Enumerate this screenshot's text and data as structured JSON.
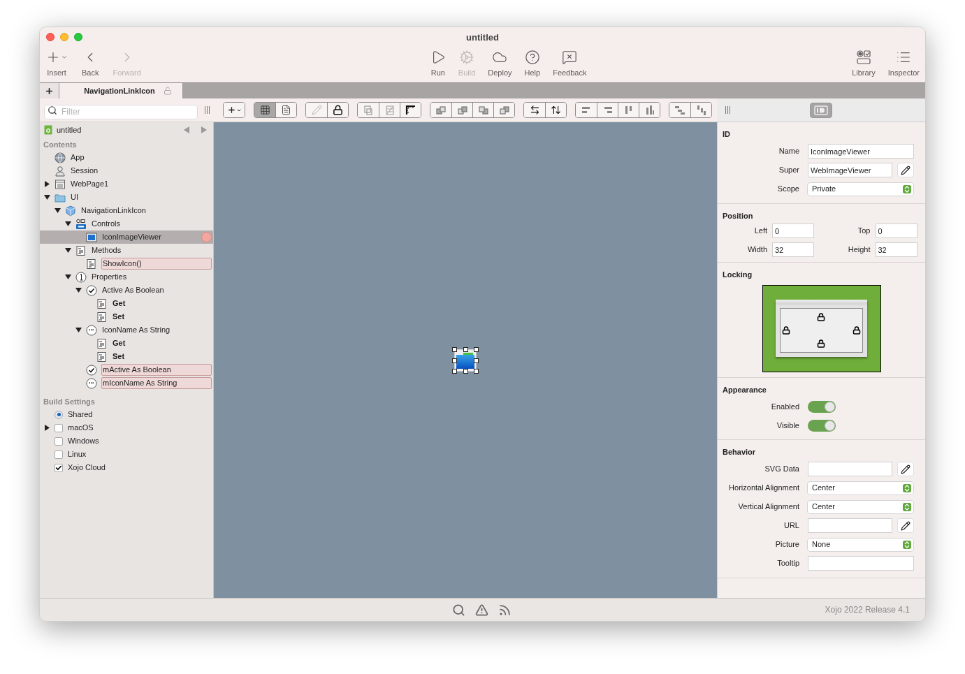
{
  "window": {
    "title": "untitled"
  },
  "toolbar_left": [
    {
      "label": "Insert",
      "kind": "insert",
      "disabled": false
    },
    {
      "label": "Back",
      "kind": "back",
      "disabled": false
    },
    {
      "label": "Forward",
      "kind": "forward",
      "disabled": true
    }
  ],
  "toolbar_center": [
    {
      "label": "Run",
      "kind": "run",
      "disabled": false
    },
    {
      "label": "Build",
      "kind": "build",
      "disabled": true
    },
    {
      "label": "Deploy",
      "kind": "deploy",
      "disabled": false
    },
    {
      "label": "Help",
      "kind": "help",
      "disabled": false
    },
    {
      "label": "Feedback",
      "kind": "feedback",
      "disabled": false
    }
  ],
  "toolbar_right": [
    {
      "label": "Library",
      "kind": "library",
      "disabled": false
    },
    {
      "label": "Inspector",
      "kind": "inspector",
      "disabled": false
    }
  ],
  "tabs": [
    {
      "label": "NavigationLinkIcon",
      "selected": true
    }
  ],
  "filter": {
    "placeholder": "Filter"
  },
  "layout_toolbar": [
    {
      "buttons": [
        {
          "kind": "add-menu",
          "selected": false
        }
      ]
    },
    {
      "buttons": [
        {
          "kind": "grid",
          "selected": true
        },
        {
          "kind": "list",
          "selected": false
        }
      ]
    },
    {
      "buttons": [
        {
          "kind": "pencil",
          "selected": false
        },
        {
          "kind": "lock",
          "selected": false
        }
      ]
    },
    {
      "buttons": [
        {
          "kind": "tab-order",
          "selected": false
        },
        {
          "kind": "stack-grid",
          "selected": false
        },
        {
          "kind": "ruler",
          "selected": false
        }
      ]
    },
    {
      "buttons": [
        {
          "kind": "to-front",
          "selected": false
        },
        {
          "kind": "forward-one",
          "selected": false
        },
        {
          "kind": "backward-one",
          "selected": false
        },
        {
          "kind": "to-back",
          "selected": false
        }
      ]
    },
    {
      "buttons": [
        {
          "kind": "same-width",
          "selected": false
        },
        {
          "kind": "same-height",
          "selected": false
        }
      ]
    },
    {
      "buttons": [
        {
          "kind": "align-left",
          "selected": false
        },
        {
          "kind": "align-right",
          "selected": false
        },
        {
          "kind": "align-top",
          "selected": false
        },
        {
          "kind": "align-bottom",
          "selected": false
        }
      ]
    },
    {
      "buttons": [
        {
          "kind": "stagger-h",
          "selected": false
        },
        {
          "kind": "stagger-v",
          "selected": false
        }
      ]
    }
  ],
  "inspector_mode": {
    "kind": "id",
    "selected": true
  },
  "sidebar": {
    "project": "untitled",
    "contents_heading": "Contents",
    "contents": [
      {
        "label": "App",
        "kind": "app",
        "selected": false,
        "highlighted": false
      },
      {
        "label": "Session",
        "kind": "session",
        "selected": false,
        "highlighted": false
      },
      {
        "label": "WebPage1",
        "kind": "webpage",
        "expanded": false,
        "selected": false,
        "highlighted": false
      },
      {
        "label": "UI",
        "kind": "folder",
        "expanded": true,
        "selected": false,
        "highlighted": false,
        "children": [
          {
            "label": "NavigationLinkIcon",
            "kind": "container",
            "expanded": true,
            "selected": false,
            "highlighted": false,
            "children": [
              {
                "label": "Controls",
                "kind": "controls",
                "expanded": true,
                "selected": false,
                "highlighted": false,
                "children": [
                  {
                    "label": "IconImageViewer",
                    "kind": "imageviewer",
                    "selected": true,
                    "highlighted": false,
                    "marked": true
                  }
                ]
              },
              {
                "label": "Methods",
                "kind": "method",
                "expanded": true,
                "selected": false,
                "highlighted": false,
                "children": [
                  {
                    "label": "ShowIcon()",
                    "kind": "method",
                    "selected": false,
                    "highlighted": true
                  }
                ]
              },
              {
                "label": "Properties",
                "kind": "integer",
                "expanded": true,
                "selected": false,
                "highlighted": false,
                "children": [
                  {
                    "label": "Active As Boolean",
                    "kind": "boolean",
                    "expanded": true,
                    "selected": false,
                    "highlighted": false,
                    "children": [
                      {
                        "label": "Get",
                        "kind": "accessor",
                        "selected": false,
                        "highlighted": false
                      },
                      {
                        "label": "Set",
                        "kind": "accessor",
                        "selected": false,
                        "highlighted": false
                      }
                    ]
                  },
                  {
                    "label": "IconName As String",
                    "kind": "string",
                    "expanded": true,
                    "selected": false,
                    "highlighted": false,
                    "children": [
                      {
                        "label": "Get",
                        "kind": "accessor",
                        "selected": false,
                        "highlighted": false
                      },
                      {
                        "label": "Set",
                        "kind": "accessor",
                        "selected": false,
                        "highlighted": false
                      }
                    ]
                  },
                  {
                    "label": "mActive As Boolean",
                    "kind": "boolean",
                    "selected": false,
                    "highlighted": true
                  },
                  {
                    "label": "mIconName As String",
                    "kind": "string",
                    "selected": false,
                    "highlighted": true
                  }
                ]
              }
            ]
          }
        ]
      }
    ],
    "build_heading": "Build Settings",
    "build": [
      {
        "label": "Shared",
        "kind": "radio",
        "checked": true
      },
      {
        "label": "macOS",
        "kind": "checkbox",
        "checked": false,
        "expanded": false
      },
      {
        "label": "Windows",
        "kind": "checkbox",
        "checked": false
      },
      {
        "label": "Linux",
        "kind": "checkbox",
        "checked": false
      },
      {
        "label": "Xojo Cloud",
        "kind": "checkbox",
        "checked": true
      }
    ]
  },
  "canvas": {
    "control": {
      "kind": "imageviewer",
      "selected": true
    }
  },
  "inspector": {
    "sections": [
      {
        "title": "ID",
        "kind": "form",
        "rows": [
          {
            "label": "Name",
            "kind": "text",
            "value": "IconImageViewer"
          },
          {
            "label": "Super",
            "kind": "text_edit",
            "value": "WebImageViewer"
          },
          {
            "label": "Scope",
            "kind": "select",
            "value": "Private"
          }
        ]
      },
      {
        "title": "Position",
        "kind": "pairs",
        "rows": [
          {
            "label": "Left",
            "value": "0"
          },
          {
            "label": "Top",
            "value": "0"
          },
          {
            "label": "Width",
            "value": "32"
          },
          {
            "label": "Height",
            "value": "32"
          }
        ]
      },
      {
        "title": "Locking",
        "kind": "locking",
        "locks": {
          "top": true,
          "left": true,
          "right": true,
          "bottom": true
        }
      },
      {
        "title": "Appearance",
        "kind": "form",
        "rows": [
          {
            "label": "Enabled",
            "kind": "switch",
            "on": true
          },
          {
            "label": "Visible",
            "kind": "switch",
            "on": true
          }
        ]
      },
      {
        "title": "Behavior",
        "kind": "form",
        "rows": [
          {
            "label": "SVG Data",
            "kind": "text_edit"
          },
          {
            "label": "Horizontal Alignment",
            "kind": "select",
            "value": "Center"
          },
          {
            "label": "Vertical Alignment",
            "kind": "select",
            "value": "Center"
          },
          {
            "label": "URL",
            "kind": "text_edit"
          },
          {
            "label": "Picture",
            "kind": "select",
            "value": "None"
          },
          {
            "label": "Tooltip",
            "kind": "text"
          }
        ]
      }
    ]
  },
  "status_bar": {
    "version": "Xojo 2022 Release 4.1"
  }
}
